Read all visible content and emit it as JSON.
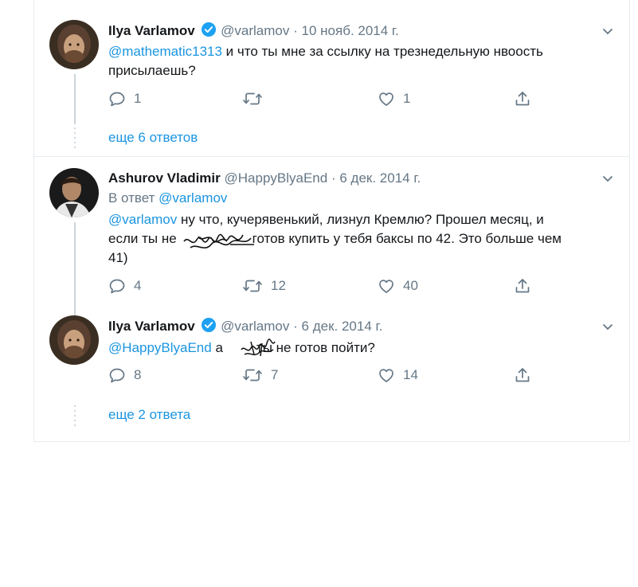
{
  "tweets": [
    {
      "name": "Ilya Varlamov",
      "handle": "@varlamov",
      "separator": "·",
      "date": "10 нояб. 2014 г.",
      "mention": "@mathematic1313",
      "text_line1": " и что ты мне за ссылку на трезнедельную нвоость",
      "text_line2": "присылаешь?",
      "replies": "1",
      "retweets": "",
      "likes": "1",
      "more_replies": "еще 6 ответов"
    },
    {
      "name": "Ashurov Vladimir",
      "handle": "@HappyBlyaEnd",
      "separator": "·",
      "date": "6 дек. 2014 г.",
      "reply_to_prefix": "В ответ ",
      "reply_to_handle": "@varlamov",
      "mention": "@varlamov",
      "text_line1": " ну что, кучерявенький, лизнул Кремлю? Прошел месяц, и",
      "text_line2a": "если ты не",
      "text_line2b": "готов купить у тебя баксы по 42. Это больше чем",
      "text_line3": "41)",
      "replies": "4",
      "retweets": "12",
      "likes": "40"
    },
    {
      "name": "Ilya Varlamov",
      "handle": "@varlamov",
      "separator": "·",
      "date": "6 дек. 2014 г.",
      "mention": "@HappyBlyaEnd",
      "text_a": " а",
      "text_b": "ты не готов пойти?",
      "replies": "8",
      "retweets": "7",
      "likes": "14",
      "more_replies": "еще 2 ответа"
    }
  ],
  "colors": {
    "link": "#1b95e0",
    "secondary": "#657786",
    "verified": "#1da1f2",
    "border": "#e6ecf0"
  },
  "icons": [
    "reply-icon",
    "retweet-icon",
    "like-icon",
    "share-icon",
    "verified-badge-icon",
    "chevron-down-icon"
  ]
}
